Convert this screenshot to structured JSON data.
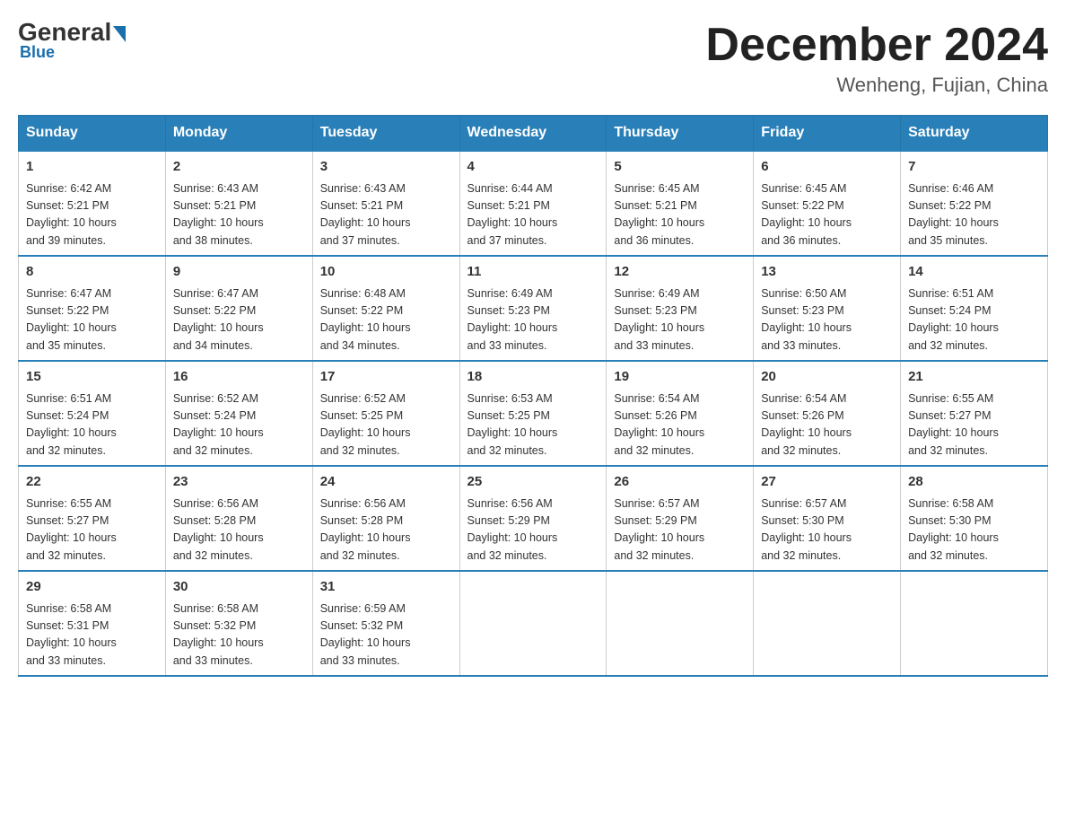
{
  "logo": {
    "general": "General",
    "blue": "Blue"
  },
  "header": {
    "title": "December 2024",
    "location": "Wenheng, Fujian, China"
  },
  "weekdays": [
    "Sunday",
    "Monday",
    "Tuesday",
    "Wednesday",
    "Thursday",
    "Friday",
    "Saturday"
  ],
  "weeks": [
    [
      {
        "day": "1",
        "sunrise": "6:42 AM",
        "sunset": "5:21 PM",
        "daylight": "10 hours and 39 minutes."
      },
      {
        "day": "2",
        "sunrise": "6:43 AM",
        "sunset": "5:21 PM",
        "daylight": "10 hours and 38 minutes."
      },
      {
        "day": "3",
        "sunrise": "6:43 AM",
        "sunset": "5:21 PM",
        "daylight": "10 hours and 37 minutes."
      },
      {
        "day": "4",
        "sunrise": "6:44 AM",
        "sunset": "5:21 PM",
        "daylight": "10 hours and 37 minutes."
      },
      {
        "day": "5",
        "sunrise": "6:45 AM",
        "sunset": "5:21 PM",
        "daylight": "10 hours and 36 minutes."
      },
      {
        "day": "6",
        "sunrise": "6:45 AM",
        "sunset": "5:22 PM",
        "daylight": "10 hours and 36 minutes."
      },
      {
        "day": "7",
        "sunrise": "6:46 AM",
        "sunset": "5:22 PM",
        "daylight": "10 hours and 35 minutes."
      }
    ],
    [
      {
        "day": "8",
        "sunrise": "6:47 AM",
        "sunset": "5:22 PM",
        "daylight": "10 hours and 35 minutes."
      },
      {
        "day": "9",
        "sunrise": "6:47 AM",
        "sunset": "5:22 PM",
        "daylight": "10 hours and 34 minutes."
      },
      {
        "day": "10",
        "sunrise": "6:48 AM",
        "sunset": "5:22 PM",
        "daylight": "10 hours and 34 minutes."
      },
      {
        "day": "11",
        "sunrise": "6:49 AM",
        "sunset": "5:23 PM",
        "daylight": "10 hours and 33 minutes."
      },
      {
        "day": "12",
        "sunrise": "6:49 AM",
        "sunset": "5:23 PM",
        "daylight": "10 hours and 33 minutes."
      },
      {
        "day": "13",
        "sunrise": "6:50 AM",
        "sunset": "5:23 PM",
        "daylight": "10 hours and 33 minutes."
      },
      {
        "day": "14",
        "sunrise": "6:51 AM",
        "sunset": "5:24 PM",
        "daylight": "10 hours and 32 minutes."
      }
    ],
    [
      {
        "day": "15",
        "sunrise": "6:51 AM",
        "sunset": "5:24 PM",
        "daylight": "10 hours and 32 minutes."
      },
      {
        "day": "16",
        "sunrise": "6:52 AM",
        "sunset": "5:24 PM",
        "daylight": "10 hours and 32 minutes."
      },
      {
        "day": "17",
        "sunrise": "6:52 AM",
        "sunset": "5:25 PM",
        "daylight": "10 hours and 32 minutes."
      },
      {
        "day": "18",
        "sunrise": "6:53 AM",
        "sunset": "5:25 PM",
        "daylight": "10 hours and 32 minutes."
      },
      {
        "day": "19",
        "sunrise": "6:54 AM",
        "sunset": "5:26 PM",
        "daylight": "10 hours and 32 minutes."
      },
      {
        "day": "20",
        "sunrise": "6:54 AM",
        "sunset": "5:26 PM",
        "daylight": "10 hours and 32 minutes."
      },
      {
        "day": "21",
        "sunrise": "6:55 AM",
        "sunset": "5:27 PM",
        "daylight": "10 hours and 32 minutes."
      }
    ],
    [
      {
        "day": "22",
        "sunrise": "6:55 AM",
        "sunset": "5:27 PM",
        "daylight": "10 hours and 32 minutes."
      },
      {
        "day": "23",
        "sunrise": "6:56 AM",
        "sunset": "5:28 PM",
        "daylight": "10 hours and 32 minutes."
      },
      {
        "day": "24",
        "sunrise": "6:56 AM",
        "sunset": "5:28 PM",
        "daylight": "10 hours and 32 minutes."
      },
      {
        "day": "25",
        "sunrise": "6:56 AM",
        "sunset": "5:29 PM",
        "daylight": "10 hours and 32 minutes."
      },
      {
        "day": "26",
        "sunrise": "6:57 AM",
        "sunset": "5:29 PM",
        "daylight": "10 hours and 32 minutes."
      },
      {
        "day": "27",
        "sunrise": "6:57 AM",
        "sunset": "5:30 PM",
        "daylight": "10 hours and 32 minutes."
      },
      {
        "day": "28",
        "sunrise": "6:58 AM",
        "sunset": "5:30 PM",
        "daylight": "10 hours and 32 minutes."
      }
    ],
    [
      {
        "day": "29",
        "sunrise": "6:58 AM",
        "sunset": "5:31 PM",
        "daylight": "10 hours and 33 minutes."
      },
      {
        "day": "30",
        "sunrise": "6:58 AM",
        "sunset": "5:32 PM",
        "daylight": "10 hours and 33 minutes."
      },
      {
        "day": "31",
        "sunrise": "6:59 AM",
        "sunset": "5:32 PM",
        "daylight": "10 hours and 33 minutes."
      },
      null,
      null,
      null,
      null
    ]
  ],
  "labels": {
    "sunrise": "Sunrise:",
    "sunset": "Sunset:",
    "daylight": "Daylight:"
  }
}
